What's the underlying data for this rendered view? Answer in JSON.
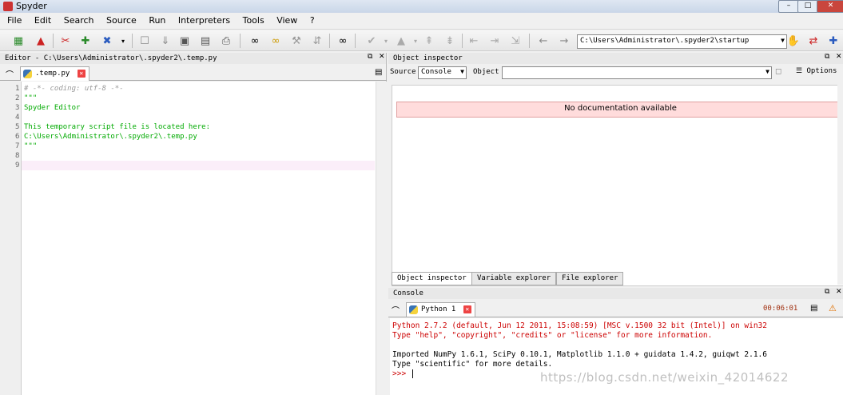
{
  "window": {
    "title": "Spyder"
  },
  "menu": [
    "File",
    "Edit",
    "Search",
    "Source",
    "Run",
    "Interpreters",
    "Tools",
    "View",
    "?"
  ],
  "toolbar": {
    "working_dir": "C:\\Users\\Administrator\\.spyder2\\startup",
    "icons": [
      "new-file",
      "open-file",
      "save-file",
      "save-all",
      "print",
      "run",
      "debug",
      "stop",
      "find",
      "replace",
      "goto",
      "back",
      "forward"
    ]
  },
  "editor": {
    "panel_title": "Editor - C:\\Users\\Administrator\\.spyder2\\.temp.py",
    "tab_label": ".temp.py",
    "line_numbers": [
      "1",
      "2",
      "3",
      "4",
      "5",
      "6",
      "7",
      "8",
      "9"
    ],
    "code_lines": [
      "# -*- coding: utf-8 -*-",
      "\"\"\"",
      "Spyder Editor",
      "",
      "This temporary script file is located here:",
      "C:\\Users\\Administrator\\.spyder2\\.temp.py",
      "\"\"\"",
      "",
      ""
    ]
  },
  "object_inspector": {
    "panel_title": "Object inspector",
    "source_label": "Source",
    "source_value": "Console",
    "object_label": "Object",
    "object_value": "",
    "options_label": "Options",
    "no_doc": "No documentation available"
  },
  "bottom_tabs": [
    "Object inspector",
    "Variable explorer",
    "File explorer"
  ],
  "console": {
    "panel_title": "Console",
    "tab_label": "Python 1",
    "elapsed": "00:06:01",
    "lines": [
      "Python 2.7.2 (default, Jun 12 2011, 15:08:59) [MSC v.1500 32 bit (Intel)] on win32",
      "Type \"help\", \"copyright\", \"credits\" or \"license\" for more information.",
      "",
      "Imported NumPy 1.6.1, SciPy 0.10.1, Matplotlib 1.1.0 + guidata 1.4.2, guiqwt 2.1.6",
      "Type \"scientific\" for more details.",
      ">>> "
    ]
  },
  "watermark": "https://blog.csdn.net/weixin_42014622",
  "colors": {
    "comment": "#999999",
    "docstring": "#00aa00",
    "error_text": "#cc0000"
  }
}
